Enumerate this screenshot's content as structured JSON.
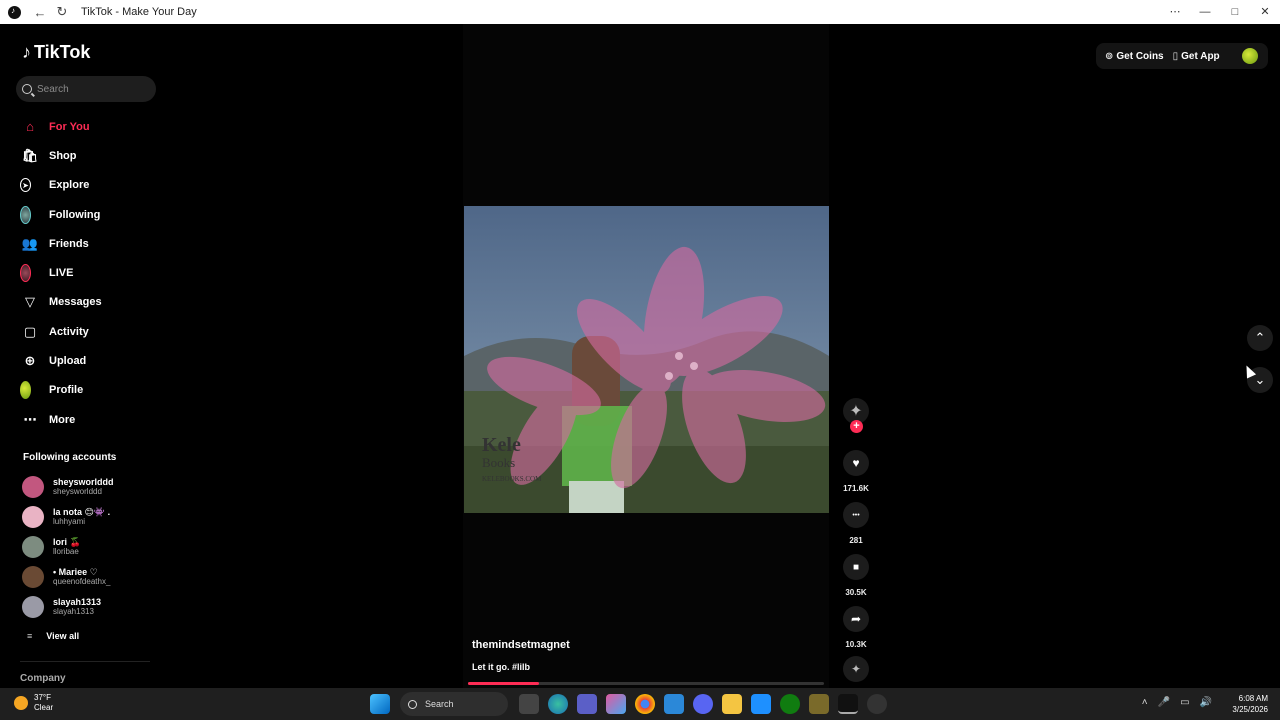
{
  "browser": {
    "title": "TikTok - Make Your Day",
    "back": "←",
    "reload": "↻",
    "menu": "⋯",
    "minimize": "—",
    "maximize": "□",
    "close": "✕"
  },
  "brand": {
    "logo": "TikTok",
    "logo_glyph": "♪"
  },
  "search": {
    "placeholder": "Search"
  },
  "nav": [
    {
      "label": "For You",
      "icon": "home-icon",
      "glyph": "⌂",
      "active": true
    },
    {
      "label": "Shop",
      "icon": "shop-bag-icon",
      "glyph": "🛍"
    },
    {
      "label": "Explore",
      "icon": "compass-icon",
      "glyph": "➤"
    },
    {
      "label": "Following",
      "icon": "following-avatar-icon",
      "glyph": ""
    },
    {
      "label": "Friends",
      "icon": "friends-icon",
      "glyph": "👥"
    },
    {
      "label": "LIVE",
      "icon": "live-avatar-icon",
      "glyph": ""
    },
    {
      "label": "Messages",
      "icon": "messages-icon",
      "glyph": "▽"
    },
    {
      "label": "Activity",
      "icon": "activity-icon",
      "glyph": "▢"
    },
    {
      "label": "Upload",
      "icon": "upload-icon",
      "glyph": "⊕"
    },
    {
      "label": "Profile",
      "icon": "profile-avatar-icon",
      "glyph": ""
    },
    {
      "label": "More",
      "icon": "more-icon",
      "glyph": "⋯"
    }
  ],
  "following_accounts": {
    "title": "Following accounts",
    "accounts": [
      {
        "name": "sheysworlddd",
        "handle": "sheysworlddd",
        "color": "#c2577f"
      },
      {
        "name": "la nota 😊👾 .",
        "handle": "luhhyami",
        "color": "#e9b3c4"
      },
      {
        "name": "lori 🍒",
        "handle": "lloribae",
        "color": "#7d8c80"
      },
      {
        "name": "• Mariee ♡",
        "handle": "queenofdeathx_",
        "color": "#6a4a34"
      },
      {
        "name": "slayah1313",
        "handle": "slayah1313",
        "color": "#9a9aa6"
      }
    ],
    "view_all": "View all",
    "view_all_glyph": "≡"
  },
  "footer": {
    "company": "Company"
  },
  "video": {
    "username": "themindsetmagnet",
    "caption": "Let it go. #lilb",
    "progress": 0.2,
    "watermark_line1": "Kele",
    "watermark_line2": "Books",
    "watermark_line3": "KELEBOOKS.COM"
  },
  "actions": {
    "follow": "+",
    "likes": "171.6K",
    "comments": "281",
    "saves": "30.5K",
    "shares": "10.3K",
    "like_glyph": "♥",
    "comment_glyph": "•••",
    "save_glyph": "■",
    "share_glyph": "➦",
    "creator_glyph": "✦"
  },
  "topbar": {
    "coins": "Get Coins",
    "app": "Get App",
    "coins_glyph": "⊚",
    "app_glyph": "▯"
  },
  "scroll": {
    "up": "⌃",
    "down": "⌄"
  },
  "taskbar": {
    "temp": "37°F",
    "condition": "Clear",
    "search": "Search",
    "time": "6:08 AM",
    "date": "3/25/2026",
    "tray_glyphs": [
      "˄",
      "🎤",
      "▭",
      "🔊"
    ]
  },
  "colors": {
    "accent": "#fe2c55",
    "background": "#000000",
    "taskbar": "#1f1f1f"
  }
}
